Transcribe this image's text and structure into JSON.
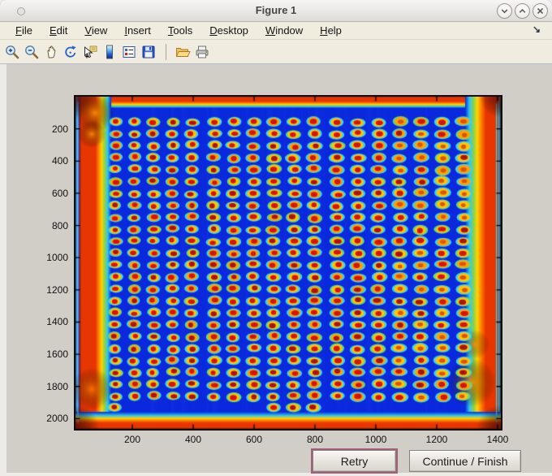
{
  "window": {
    "title": "Figure 1"
  },
  "titlebar": {
    "buttons": [
      {
        "name": "window-minimize-button",
        "icon": "chevron-down-icon"
      },
      {
        "name": "window-maximize-button",
        "icon": "chevron-up-icon"
      },
      {
        "name": "window-close-button",
        "icon": "close-icon"
      }
    ]
  },
  "menu": {
    "items": [
      "File",
      "Edit",
      "View",
      "Insert",
      "Tools",
      "Desktop",
      "Window",
      "Help"
    ],
    "dock_arrow": "↘"
  },
  "toolbar": {
    "icons": [
      "zoom-in",
      "zoom-out",
      "pan",
      "rotate-3d",
      "data-cursor",
      "colorbar",
      "insert-legend",
      "save",
      "separator",
      "open",
      "print"
    ]
  },
  "plot": {
    "x_ticks": [
      200,
      400,
      600,
      800,
      1000,
      1200,
      1400
    ],
    "y_ticks": [
      200,
      400,
      600,
      800,
      1000,
      1200,
      1400,
      1600,
      1800,
      2000
    ],
    "tick_color": "#000000"
  },
  "figure_image": {
    "description": "Thermal (jet colormap) image of a microarray plate: deep blue field, grid of hot spots with red cores, yellow rings and cyan halos, hot red frame around the plate edges with orange corner blobs",
    "colormap": "jet",
    "spot_grid": {
      "rows": 25,
      "cols": 18
    },
    "colors": {
      "field": "#0a28dc",
      "halo": "#3ad4ee",
      "halo_alt": "#5ed88a",
      "ring": "#ffc400",
      "ring_alt": "#ffa200",
      "core": "#d81400",
      "core_dark": "#b01208",
      "core_orange": "#e05200",
      "frame_red": "#e83600",
      "frame_orange": "#ff7a00",
      "frame_yellow": "#ffd400",
      "frame_green": "#8cd24a",
      "frame_cyan": "#2fc8ee",
      "corner_dark": "#6e100a"
    }
  },
  "buttons": {
    "retry": "Retry",
    "continue_finish": "Continue / Finish"
  }
}
